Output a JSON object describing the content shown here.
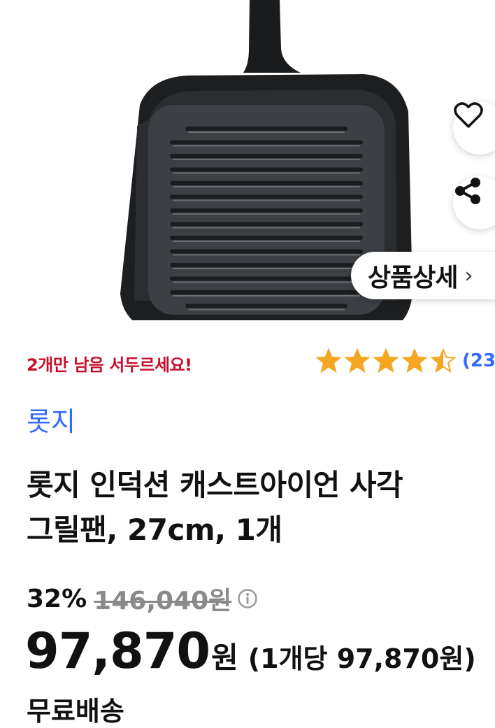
{
  "product": {
    "stock_alert": "2개만 남음 서두르세요!",
    "rating": {
      "value": 4.5,
      "max": 5,
      "count_text": "(23"
    },
    "brand": "롯지",
    "title_line1": "롯지 인덕션 캐스트아이언 사각",
    "title_line2": "그릴팬, 27cm, 1개",
    "discount_percent": "32%",
    "original_price": "146,040원",
    "sale_price": "97,870",
    "sale_price_unit": "원",
    "unit_price": "(1개당 97,870원)",
    "shipping": "무료배송"
  },
  "hero": {
    "detail_button_label": "상품상세",
    "detail_chevron": "›"
  },
  "colors": {
    "accent_blue": "#346aff",
    "alert_red": "#c8102e",
    "star_orange": "#f5a623",
    "strike_gray": "#8a8a8a"
  },
  "icons": [
    "heart-icon",
    "share-icon",
    "chevron-right-icon",
    "star-icon",
    "info-icon"
  ]
}
